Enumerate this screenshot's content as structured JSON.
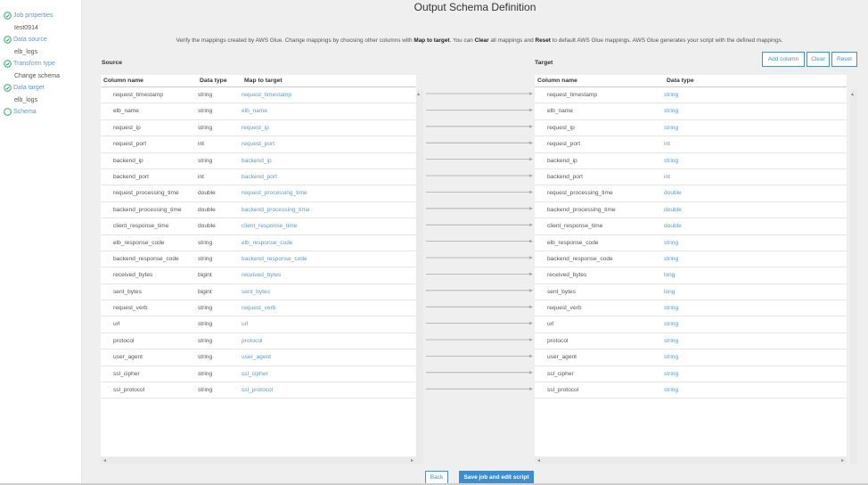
{
  "sidebar": {
    "steps": [
      {
        "label": "Job properties",
        "sub": "test0914",
        "done": true
      },
      {
        "label": "Data source",
        "sub": "elb_logs",
        "done": true
      },
      {
        "label": "Transform type",
        "sub": "Change schema",
        "done": true
      },
      {
        "label": "Data target",
        "sub": "elb_logs",
        "done": true
      },
      {
        "label": "Schema",
        "sub": null,
        "done": false
      }
    ]
  },
  "header": {
    "title": "Output Schema Definition",
    "description": {
      "part1": "Verify the mappings created by AWS Glue. Change mappings by choosing other columns with ",
      "b1": "Map to target",
      "part2": ". You can ",
      "b2": "Clear",
      "part3": " all mappings and ",
      "b3": "Reset",
      "part4": " to default AWS Glue mappings. AWS Glue generates your script with the defined mappings."
    }
  },
  "toolbar": {
    "add_column": "Add column",
    "clear": "Clear",
    "reset": "Reset"
  },
  "source": {
    "title": "Source",
    "headers": [
      "Column name",
      "Data type",
      "Map to target"
    ],
    "rows": [
      {
        "name": "request_timestamp",
        "type": "string",
        "map": "request_timestamp"
      },
      {
        "name": "elb_name",
        "type": "string",
        "map": "elb_name"
      },
      {
        "name": "request_ip",
        "type": "string",
        "map": "request_ip"
      },
      {
        "name": "request_port",
        "type": "int",
        "map": "request_port"
      },
      {
        "name": "backend_ip",
        "type": "string",
        "map": "backend_ip"
      },
      {
        "name": "backend_port",
        "type": "int",
        "map": "backend_port"
      },
      {
        "name": "request_processing_time",
        "type": "double",
        "map": "request_processing_time"
      },
      {
        "name": "backend_processing_time",
        "type": "double",
        "map": "backend_processing_time"
      },
      {
        "name": "client_response_time",
        "type": "double",
        "map": "client_response_time"
      },
      {
        "name": "elb_response_code",
        "type": "string",
        "map": "elb_response_code"
      },
      {
        "name": "backend_response_code",
        "type": "string",
        "map": "backend_response_code"
      },
      {
        "name": "received_bytes",
        "type": "bigint",
        "map": "received_bytes"
      },
      {
        "name": "sent_bytes",
        "type": "bigint",
        "map": "sent_bytes"
      },
      {
        "name": "request_verb",
        "type": "string",
        "map": "request_verb"
      },
      {
        "name": "url",
        "type": "string",
        "map": "url"
      },
      {
        "name": "protocol",
        "type": "string",
        "map": "protocol"
      },
      {
        "name": "user_agent",
        "type": "string",
        "map": "user_agent"
      },
      {
        "name": "ssl_cipher",
        "type": "string",
        "map": "ssl_cipher"
      },
      {
        "name": "ssl_protocol",
        "type": "string",
        "map": "ssl_protocol"
      }
    ]
  },
  "target": {
    "title": "Target",
    "headers": [
      "Column name",
      "Data type"
    ],
    "rows": [
      {
        "name": "request_timestamp",
        "type": "string"
      },
      {
        "name": "elb_name",
        "type": "string"
      },
      {
        "name": "request_ip",
        "type": "string"
      },
      {
        "name": "request_port",
        "type": "int"
      },
      {
        "name": "backend_ip",
        "type": "string"
      },
      {
        "name": "backend_port",
        "type": "int"
      },
      {
        "name": "request_processing_time",
        "type": "double"
      },
      {
        "name": "backend_processing_time",
        "type": "double"
      },
      {
        "name": "client_response_time",
        "type": "double"
      },
      {
        "name": "elb_response_code",
        "type": "string"
      },
      {
        "name": "backend_response_code",
        "type": "string"
      },
      {
        "name": "received_bytes",
        "type": "long"
      },
      {
        "name": "sent_bytes",
        "type": "long"
      },
      {
        "name": "request_verb",
        "type": "string"
      },
      {
        "name": "url",
        "type": "string"
      },
      {
        "name": "protocol",
        "type": "string"
      },
      {
        "name": "user_agent",
        "type": "string"
      },
      {
        "name": "ssl_cipher",
        "type": "string"
      },
      {
        "name": "ssl_protocol",
        "type": "string"
      }
    ]
  },
  "footer": {
    "back": "Back",
    "save": "Save job and edit script"
  },
  "colors": {
    "accent": "#5a9bd5",
    "check": "#3cb371",
    "primary_button": "#3a8fd0"
  },
  "icons": {
    "step_done": "check-circle-icon",
    "step_pending": "empty-circle-icon",
    "mapping_arrow": "arrow-right-icon"
  }
}
